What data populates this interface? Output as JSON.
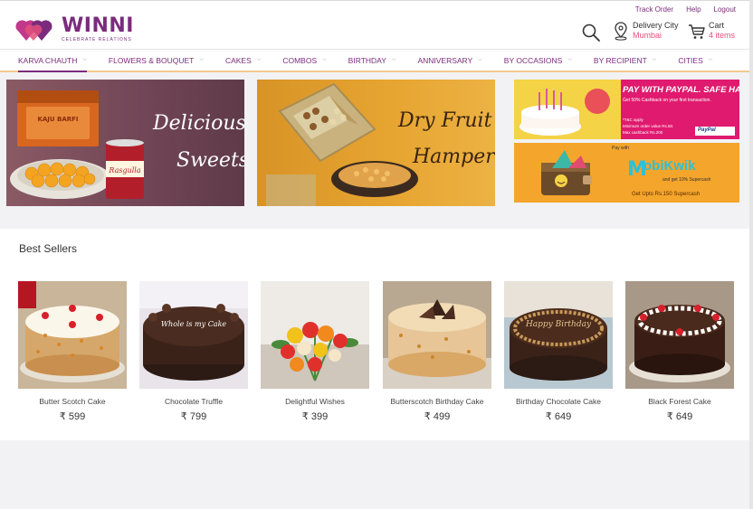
{
  "brand": {
    "name": "WINNI",
    "tagline": "CELEBRATE RELATIONS"
  },
  "top_links": [
    "Track Order",
    "Help",
    "Logout"
  ],
  "delivery": {
    "title": "Delivery City",
    "city": "Mumbai"
  },
  "cart": {
    "title": "Cart",
    "count": "4 items"
  },
  "nav": [
    "KARVA CHAUTH",
    "FLOWERS & BOUQUET",
    "CAKES",
    "COMBOS",
    "BIRTHDAY",
    "ANNIVERSARY",
    "BY OCCASIONS",
    "BY RECIPIENT",
    "CITIES"
  ],
  "banners": {
    "sweets": {
      "line1": "Delicious",
      "line2": "Sweets",
      "box_text": "KAJU BARFI",
      "can_text": "Rasgulla"
    },
    "dry_fruit": {
      "line1": "Dry Fruit",
      "line2": "Hamper"
    },
    "paypal": {
      "headline": "PAY WITH PAYPAL. SAFE HAI.",
      "sub": "Get 50% Cashback on your first transaction.",
      "tc1": "*T&C apply",
      "tc2": "Minimum order value Rs.50.",
      "tc3": "Max cashback Rs.200",
      "logo": "PayPal"
    },
    "mobikwik": {
      "pay_with": "Pay with",
      "brand": "obiKwik",
      "extra": "and get 10% Supercash",
      "sub": "Get Upto Rs.150 Supercash"
    }
  },
  "best_sellers": {
    "title": "Best Sellers",
    "products": [
      {
        "name": "Butter Scotch Cake",
        "price": "₹ 599"
      },
      {
        "name": "Chocolate Truffle",
        "price": "₹ 799",
        "cake_text": "Whole is my Cake"
      },
      {
        "name": "Delightful Wishes",
        "price": "₹ 399"
      },
      {
        "name": "Butterscotch Birthday Cake",
        "price": "₹ 499"
      },
      {
        "name": "Birthday Chocolate Cake",
        "price": "₹ 649",
        "cake_text": "Happy Birthday"
      },
      {
        "name": "Black Forest Cake",
        "price": "₹ 649"
      }
    ]
  },
  "colors": {
    "brand_purple": "#7b2b7d",
    "accent_pink": "#e0507a",
    "nav_underline": "#f3c98b"
  }
}
